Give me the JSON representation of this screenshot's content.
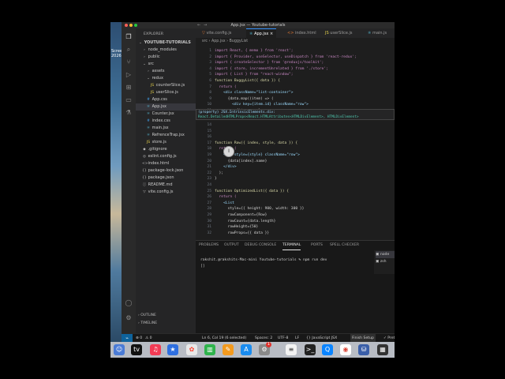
{
  "window": {
    "title": "App.jsx — Youtube-tutorials"
  },
  "desktop": {
    "label": "Scree\n2026"
  },
  "sidebar": {
    "header": "EXPLORER",
    "items": [
      {
        "label": "YOUTUBE-TUTORIALS",
        "indent": 0,
        "icon": "⌄"
      },
      {
        "label": "node_modules",
        "indent": 1,
        "icon": "›"
      },
      {
        "label": "public",
        "indent": 1,
        "icon": "›"
      },
      {
        "label": "src",
        "indent": 1,
        "icon": "⌄"
      },
      {
        "label": "assets",
        "indent": 2,
        "icon": "›"
      },
      {
        "label": "redux",
        "indent": 2,
        "icon": "⌄"
      },
      {
        "label": "counterSlice.js",
        "indent": 3,
        "icon": "JS"
      },
      {
        "label": "userSlice.js",
        "indent": 3,
        "icon": "JS"
      },
      {
        "label": "App.css",
        "indent": 2,
        "icon": "#"
      },
      {
        "label": "App.jsx",
        "indent": 2,
        "icon": "⚛",
        "selected": true
      },
      {
        "label": "Counter.jsx",
        "indent": 2,
        "icon": "⚛"
      },
      {
        "label": "index.css",
        "indent": 2,
        "icon": "#"
      },
      {
        "label": "main.jsx",
        "indent": 2,
        "icon": "⚛"
      },
      {
        "label": "RefrenceTrap.jsx",
        "indent": 2,
        "icon": "⚛"
      },
      {
        "label": "store.js",
        "indent": 2,
        "icon": "JS"
      },
      {
        "label": ".gitignore",
        "indent": 1,
        "icon": "◆"
      },
      {
        "label": "eslint.config.js",
        "indent": 1,
        "icon": "◎"
      },
      {
        "label": "index.html",
        "indent": 1,
        "icon": "<>"
      },
      {
        "label": "package-lock.json",
        "indent": 1,
        "icon": "{}"
      },
      {
        "label": "package.json",
        "indent": 1,
        "icon": "{}"
      },
      {
        "label": "README.md",
        "indent": 1,
        "icon": "ⓘ"
      },
      {
        "label": "vite.config.js",
        "indent": 1,
        "icon": "▽"
      }
    ],
    "outline": "OUTLINE",
    "timeline": "TIMELINE"
  },
  "tabs": [
    {
      "label": "vite.config.js",
      "icon": "▽"
    },
    {
      "label": "App.jsx",
      "icon": "⚛",
      "active": true
    },
    {
      "label": "index.html",
      "icon": "<>"
    },
    {
      "label": "userSlice.js",
      "icon": "JS"
    },
    {
      "label": "main.js",
      "icon": "⚛"
    }
  ],
  "breadcrumb": "src › App.jsx › BuggyList",
  "editor": {
    "lines": [
      {
        "n": "1",
        "t": "import React, { memo } from 'react';"
      },
      {
        "n": "2",
        "t": "import { Provider, useSelector, useDispatch } from 'react-redux';"
      },
      {
        "n": "3",
        "t": "import { createSelector } from '@reduxjs/toolkit';"
      },
      {
        "n": "4",
        "t": "import { store, incrementUnrelated } from './store';"
      },
      {
        "n": "5",
        "t": "import { List } from \"react-window\";"
      },
      {
        "n": "6",
        "t": "function BuggyList({ data }) {"
      },
      {
        "n": "7",
        "t": "  return ("
      },
      {
        "n": "8",
        "t": "    <div className=\"list-container\">"
      },
      {
        "n": "9",
        "t": "      {data.map((item) => ("
      },
      {
        "n": "10",
        "t": "        <div key={item.id} className=\"row\">"
      },
      {
        "n": "11",
        "t": "          {item.name}"
      },
      {
        "n": "14",
        "t": ""
      },
      {
        "n": "15",
        "t": ""
      },
      {
        "n": "16",
        "t": ""
      },
      {
        "n": "17",
        "t": "function Row({ index, style, data }) {"
      },
      {
        "n": "18",
        "t": "  return ("
      },
      {
        "n": "19",
        "t": "    <div style={style} className=\"row\">"
      },
      {
        "n": "20",
        "t": "      {data[index].name}"
      },
      {
        "n": "21",
        "t": "    </div>"
      },
      {
        "n": "22",
        "t": "  );"
      },
      {
        "n": "23",
        "t": "}"
      },
      {
        "n": "24",
        "t": ""
      },
      {
        "n": "25",
        "t": "function OptimizedList({ data }) {"
      },
      {
        "n": "26",
        "t": "  return ("
      },
      {
        "n": "27",
        "t": "    <List"
      },
      {
        "n": "28",
        "t": "      style={{ height: 900, width: 300 }}"
      },
      {
        "n": "29",
        "t": "      rowComponent={Row}"
      },
      {
        "n": "30",
        "t": "      rowCount={data.length}"
      },
      {
        "n": "31",
        "t": "      rowHeight={50}"
      },
      {
        "n": "32",
        "t": "      rowProps={{ data }}"
      }
    ],
    "hover": {
      "line1": "(property) JSX.IntrinsicElements.div:",
      "line2": "React.DetailedHTMLProps<React.HTMLAttributes<HTMLDivElement>, HTMLDivElement>"
    }
  },
  "panel": {
    "tabs": [
      "PROBLEMS",
      "OUTPUT",
      "DEBUG CONSOLE",
      "TERMINAL",
      "PORTS",
      "SPELL CHECKER"
    ],
    "terminal_lines": [
      "rakshit.@rakshits-Mac-mini Youtube-tutorials % npm run dev",
      "[]"
    ],
    "terminals": [
      "node",
      "zsh"
    ]
  },
  "status": {
    "errors": "⊗ 0",
    "warnings": "⚠ 0",
    "position": "Ln 6, Col 19 (6 selected)",
    "spaces": "Spaces: 2",
    "encoding": "UTF-8",
    "eol": "LF",
    "language": "{} JavaScript JSX",
    "finish": "Finish Setup",
    "prettier": "✓ Prettier"
  },
  "dock_badge": "1",
  "colors": {
    "accent": "#3794ff",
    "keyword": "#569cd6",
    "string": "#ce9178",
    "function": "#dcdcaa"
  }
}
